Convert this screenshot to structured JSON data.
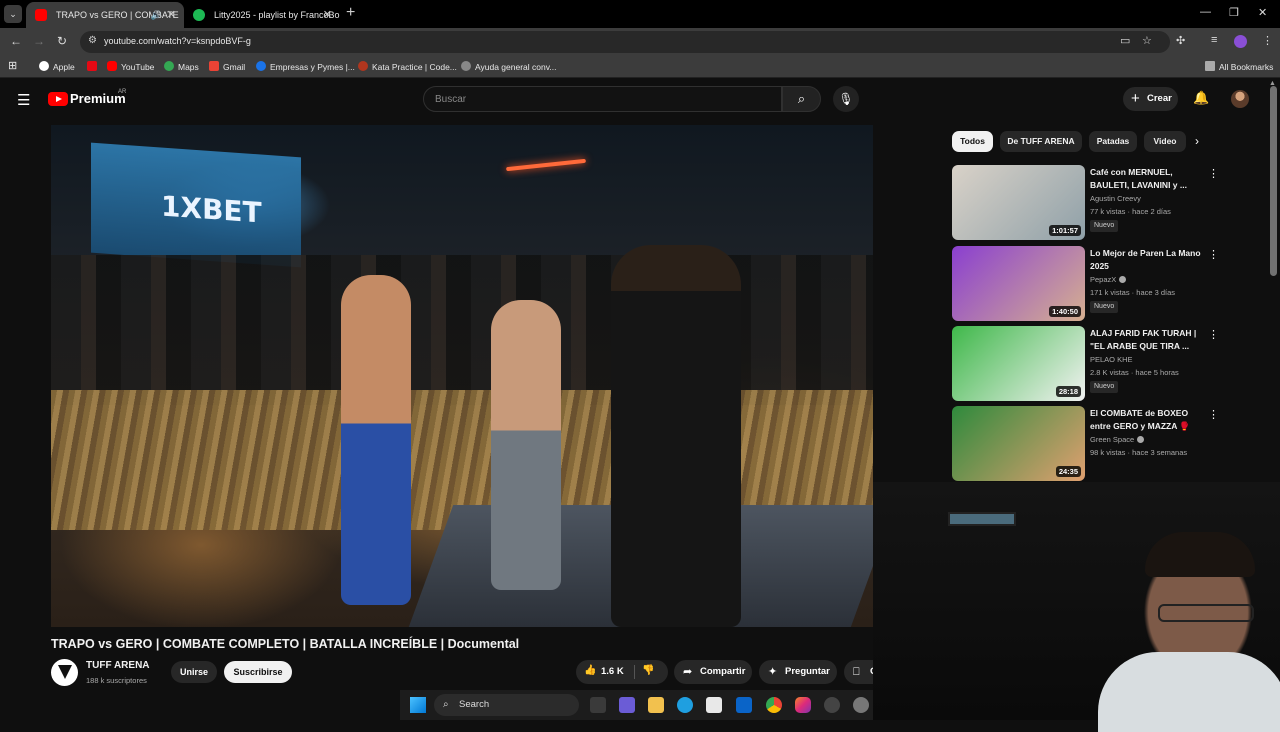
{
  "browser": {
    "tabs": [
      {
        "title": "TRAPO vs GERO | COMBATE",
        "active": true
      },
      {
        "title": "Litty2025 - playlist by FrancoBo",
        "active": false
      }
    ],
    "url": "youtube.com/watch?v=ksnpdoBVF-g",
    "bookmarks": [
      "Apple",
      "YouTube",
      "Maps",
      "Gmail",
      "Empresas y Pymes |...",
      "Kata Practice | Code...",
      "Ayuda general conv..."
    ],
    "all_bookmarks": "All Bookmarks"
  },
  "yt": {
    "logo_word": "Premium",
    "country": "AR",
    "search_placeholder": "Buscar",
    "create_label": "Crear"
  },
  "video": {
    "title": "TRAPO vs GERO | COMBATE COMPLETO | BATALLA INCREÍBLE | Documental",
    "overlay_brand": "1XBET",
    "channel": "TUFF ARENA",
    "subscribers": "188 k suscriptores",
    "join_label": "Unirse",
    "subscribe_label": "Suscribirse",
    "likes": "1.6 K",
    "share_label": "Compartir",
    "ask_label": "Preguntar",
    "save_label_fragment": "G"
  },
  "chips": [
    "Todos",
    "De TUFF ARENA",
    "Patadas",
    "Video"
  ],
  "recommendations": [
    {
      "title": "Café con MERNUEL, BAULETI, LAVANINI y ...",
      "channel": "Agustin Creevy",
      "meta": "77 k vistas · hace 2 días",
      "badge": "Nuevo",
      "duration": "1:01:57",
      "verified": false,
      "thumb_colors": [
        "#d9d2c8",
        "#8fa0a8"
      ]
    },
    {
      "title": "Lo Mejor de Paren La Mano 2025",
      "channel": "PepazX",
      "meta": "171 k vistas · hace 3 días",
      "badge": "Nuevo",
      "duration": "1:40:50",
      "verified": true,
      "thumb_colors": [
        "#8a3fd0",
        "#d6b090"
      ]
    },
    {
      "title": "ALAJ FARID FAK TURAH | \"EL ARABE QUE TIRA ...",
      "channel": "PELAO KHE",
      "meta": "2.8 K vistas · hace 5 horas",
      "badge": "Nuevo",
      "duration": "28:18",
      "verified": false,
      "thumb_colors": [
        "#3fb84a",
        "#f2f2f2"
      ]
    },
    {
      "title": "El COMBATE de BOXEO entre GERO y MAZZA 🥊",
      "channel": "Green Space",
      "meta": "98 k vistas · hace 3 semanas",
      "badge": "",
      "duration": "24:35",
      "verified": true,
      "thumb_colors": [
        "#2e8a3c",
        "#e0a070"
      ]
    }
  ],
  "taskbar": {
    "search_label": "Search"
  },
  "colors": {
    "accent_red": "#ff0000",
    "bg": "#0f0f0f",
    "chip_bg": "#272727"
  }
}
